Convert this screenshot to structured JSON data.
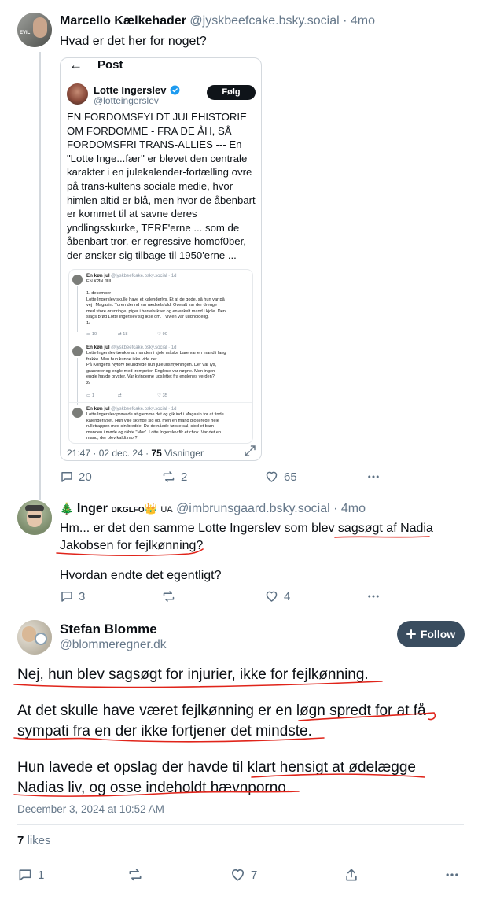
{
  "post1": {
    "author_name": "Marcello Kælkehader",
    "handle": "@jyskbeefcake.bsky.social",
    "separator": "·",
    "time": "4mo",
    "avatar_text": "EVIL",
    "text": "Hvad er det her for noget?",
    "embed": {
      "back_label": "←",
      "header_title": "Post",
      "author_name": "Lotte Ingerslev",
      "handle": "@lotteingerslev",
      "follow_label": "Følg",
      "text": "EN FORDOMSFYLDT JULEHISTORIE OM FORDOMME - FRA DE ÅH, SÅ FORDOMSFRI TRANS-ALLIES --- En \"Lotte Inge...fær\" er blevet den centrale karakter i en julekalender-fortælling ovre på trans-kultens sociale medie, hvor himlen altid er blå, men hvor de åbenbart er kommet til at savne deres yndlingsskurke, TERF'erne ... som de åbenbart tror, er regressive homof0ber, der ønsker sig tilbage til 1950'erne ...",
      "footer_time": "21:47 · 02 dec. 24 ·",
      "footer_views_count": "75",
      "footer_views_label": "Visninger",
      "mini_posts": [
        {
          "name": "En køn jul",
          "handle": "@jyskbeefcake.bsky.social · 1d",
          "lines": [
            "EN KØN JUL",
            "",
            "1. december",
            "Lotte Ingerslev skulle have et kalenderlys. Et af de gode, så hun var på",
            "vej i Magasin. Turen derind var rædselsfuld. Overalt var der drenge",
            "med store ørenringe, piger i herrebukser og en enkelt mand i kjole. Den",
            "slags brød Lotte Ingerslev sig ikke om. Tvivlen var uudholdelig.",
            "1/"
          ],
          "stats": [
            "10",
            "18",
            "90"
          ]
        },
        {
          "name": "En køn jul",
          "handle": "@jyskbeefcake.bsky.social · 1d",
          "lines": [
            "Lotte Ingerslev tænkte at manden i kjole måske bare var en mand i lang",
            "frakke. Men hun kunne ikke vide det.",
            "På Kongens Nytorv beundrede hun juleudsmykningen. Der var lys,",
            "granræer og engle med trompeter. Englene var nøgne. Men ingen",
            "engle havde bryster. Var kvinderne udslettet fra englenes verden?",
            "2/"
          ],
          "stats": [
            "1",
            "",
            "35"
          ]
        },
        {
          "name": "En køn jul",
          "handle": "@jyskbeefcake.bsky.social · 1d",
          "lines": [
            "Lotte Ingerslev prøvede at glemme det og gik ind i Magasin for at finde",
            "kalenderlyset. Hun ville skynde sig op, men en mand blokerede hele",
            "rulletrappen med sin bredde. Da de nåede første sal, stod et barn",
            "manden i møde og råbte \"Mor\". Lotte Ingerslev fik et chok. Var det en",
            "mand, der blev kaldt mor?"
          ],
          "stats": []
        }
      ]
    },
    "replies": "20",
    "reposts": "2",
    "likes": "65"
  },
  "post2": {
    "author_emoji": "🎄",
    "author_name": "Inger",
    "author_badges": "DKGLFO",
    "crown": "👑",
    "ua": "UA",
    "handle": "@imbrunsgaard.bsky.social",
    "separator": "·",
    "time": "4mo",
    "text_line1": "Hm... er det den samme Lotte Ingerslev som blev sagsøgt af Nadia",
    "text_line2": "Jakobsen for fejlkønning?",
    "text_line3": "Hvordan endte det egentligt?",
    "replies": "3",
    "reposts": "",
    "likes": "4"
  },
  "post3": {
    "author_name": "Stefan Blomme",
    "handle": "@blommeregner.dk",
    "follow_label": "Follow",
    "para1": "Nej, hun blev sagsøgt for injurier, ikke for fejlkønning.",
    "para2_line1": "At det skulle have været fejlkønning er en løgn spredt for at få",
    "para2_line2": "sympati fra en der ikke fortjener det mindste.",
    "para3_line1": "Hun lavede et opslag der havde til klart hensigt at ødelægge",
    "para3_line2": "Nadias liv, og osse indeholdt hævnporno.",
    "timestamp": "December 3, 2024 at 10:52 AM",
    "likes_count": "7",
    "likes_label": "likes",
    "replies": "1",
    "likes": "7"
  },
  "colors": {
    "accent_dark": "#3a4d5f",
    "muted": "#66788a",
    "underline_red": "#e0241a",
    "verified_blue": "#1d9bf0"
  },
  "icons": [
    "reply-icon",
    "repost-icon",
    "like-icon",
    "more-icon",
    "share-icon",
    "plus-icon",
    "verified-icon",
    "expand-icon",
    "back-arrow-icon"
  ]
}
